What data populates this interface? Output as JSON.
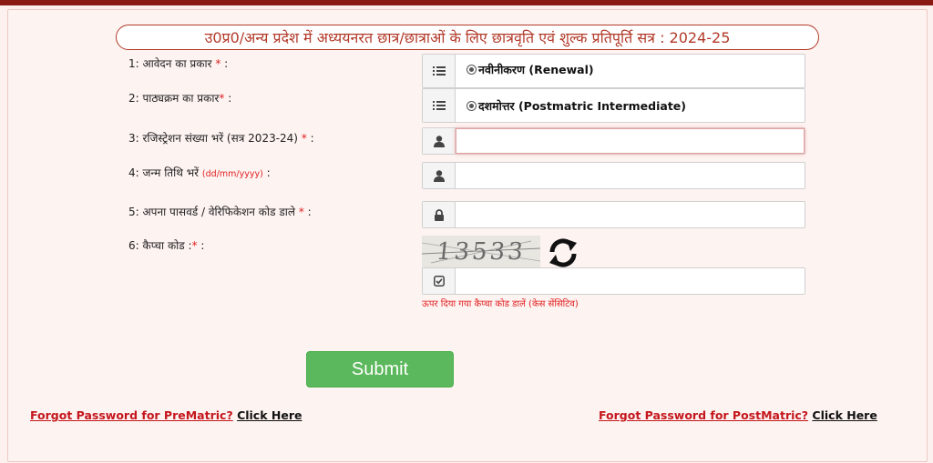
{
  "form": {
    "title": "उ0प्र0/अन्य प्रदेश में अध्ययनरत छात्र/छात्राओं के लिए छात्रवृति एवं शुल्क प्रतिपूर्ति सत्र : 2024-25",
    "fields": [
      {
        "label": "1: आवेदन का प्रकार",
        "required": "*",
        "suffix": " :",
        "value": "नवीनीकरण (Renewal)",
        "icon": "list-icon"
      },
      {
        "label": "2: पाठ्यक्रम का प्रकार",
        "required": "*",
        "suffix": " :",
        "value": "दशमोत्तर (Postmatric Intermediate)",
        "icon": "list-icon"
      },
      {
        "label": "3: रजिस्ट्रेशन संख्या भरें (सत्र 2023-24)",
        "required": "*",
        "suffix": " :",
        "value": "",
        "icon": "user-icon"
      },
      {
        "label": "4: जन्म तिथि भरें",
        "hint": "(dd/mm/yyyy)",
        "suffix": " :",
        "value": "",
        "icon": "user-icon"
      },
      {
        "label": "5: अपना पासवर्ड / वेरिफिकेशन कोड डाले",
        "required": "*",
        "suffix": " :",
        "value": "",
        "icon": "lock-icon"
      },
      {
        "label": "6: कैप्चा कोड :",
        "required": "*",
        "suffix": " :",
        "value": "",
        "icon": "check-square-icon"
      }
    ],
    "captcha_text": "13533",
    "captcha_hint": "ऊपर दिया गया कैप्चा कोड डालें (केस सेंसिटिव)",
    "submit_label": "Submit"
  },
  "links": {
    "prematric_text": "Forgot Password for PreMatric?",
    "prematric_action": "Click Here",
    "postmatric_text": "Forgot Password for PostMatric?",
    "postmatric_action": "Click Here"
  },
  "colors": {
    "header_bar": "#8b1a12",
    "accent_red": "#c4161c",
    "submit_green": "#5cb85c",
    "background": "#fdf1ef"
  }
}
